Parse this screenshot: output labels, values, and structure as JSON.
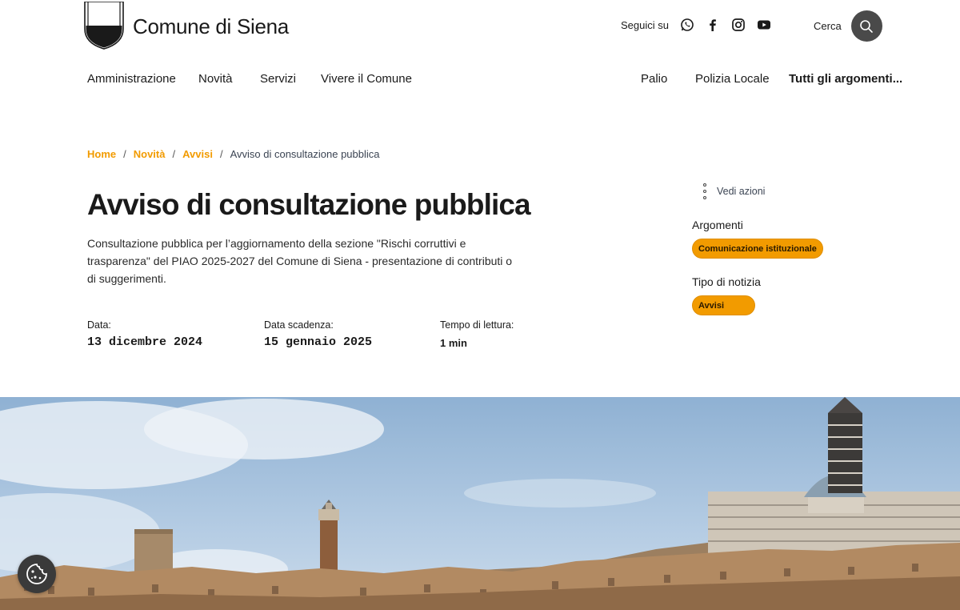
{
  "header": {
    "site_name": "Comune di Siena",
    "social_label": "Seguici su",
    "social_icons": [
      "whatsapp-icon",
      "facebook-icon",
      "instagram-icon",
      "youtube-icon"
    ],
    "search_label": "Cerca"
  },
  "nav": {
    "left": [
      "Amministrazione",
      "Novità",
      "Servizi",
      "Vivere il Comune"
    ],
    "right": [
      "Palio",
      "Polizia Locale",
      "Tutti gli argomenti..."
    ]
  },
  "breadcrumb": {
    "items": [
      "Home",
      "Novità",
      "Avvisi"
    ],
    "separator": "/",
    "current": "Avviso di consultazione pubblica"
  },
  "article": {
    "title": "Avviso di consultazione pubblica",
    "description": "Consultazione pubblica per l’aggiornamento della sezione \"Rischi corruttivi e trasparenza\" del PIAO 2025-2027 del Comune di Siena - presentazione di contributi o di suggerimenti.",
    "meta": {
      "date_label": "Data:",
      "date_value": "13 dicembre 2024",
      "deadline_label": "Data scadenza:",
      "deadline_value": "15 gennaio 2025",
      "reading_label": "Tempo di lettura:",
      "reading_value": "1 min"
    }
  },
  "sidebar": {
    "actions_label": "Vedi azioni",
    "topics_heading": "Argomenti",
    "topic_chip": "Comunicazione istituzionale",
    "news_type_heading": "Tipo di notizia",
    "news_type_chip": "Avvisi"
  },
  "colors": {
    "accent": "#f29b00",
    "text": "#1a1a1a",
    "search_button": "#4a4a4a"
  }
}
